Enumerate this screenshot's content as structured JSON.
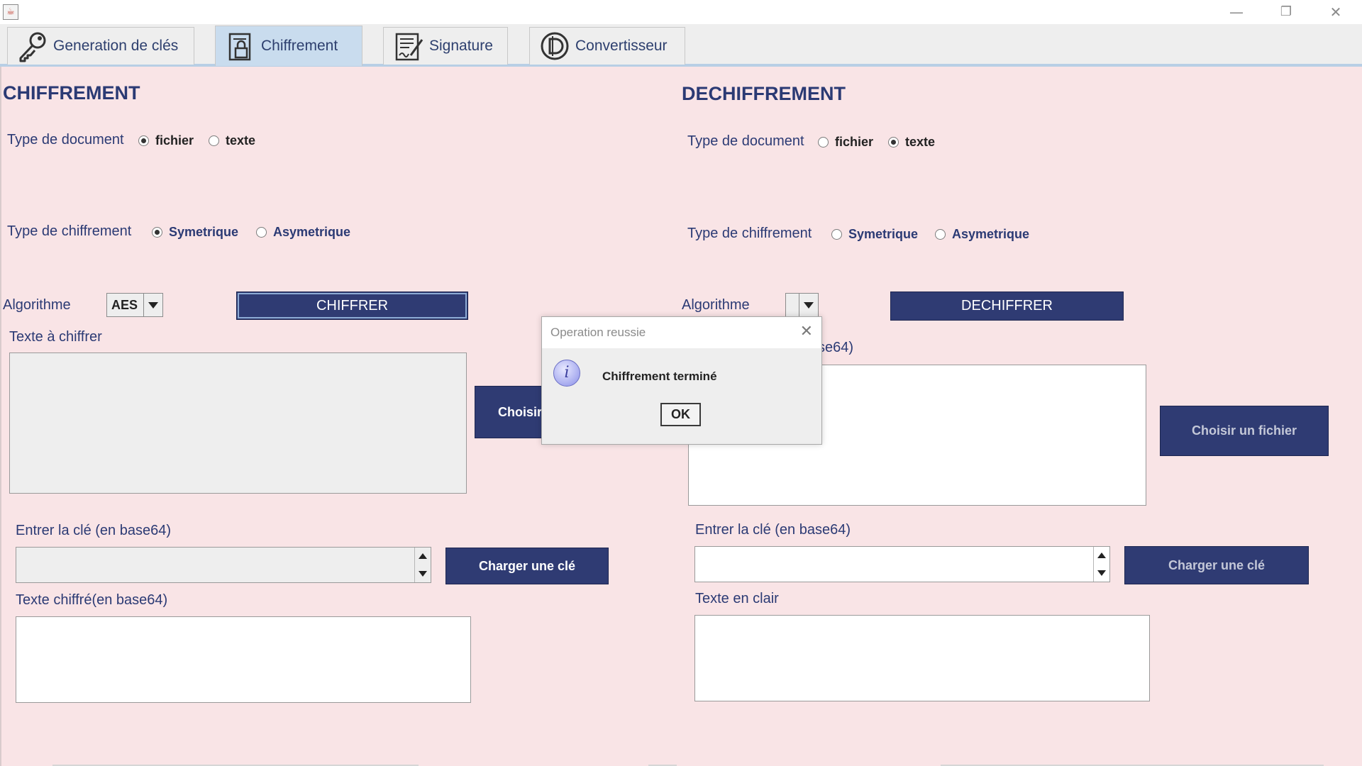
{
  "window": {
    "minimize_glyph": "—",
    "restore_glyph": "❐",
    "close_glyph": "✕"
  },
  "tabs": [
    {
      "label": "Generation de clés",
      "icon": "key-icon",
      "active": false
    },
    {
      "label": "Chiffrement",
      "icon": "lock-document-icon",
      "active": true
    },
    {
      "label": "Signature",
      "icon": "signature-document-icon",
      "active": false
    },
    {
      "label": "Convertisseur",
      "icon": "converter-icon",
      "active": false
    }
  ],
  "encrypt": {
    "title": "CHIFFREMENT",
    "doc_type_label": "Type de document",
    "doc_type_options": [
      "fichier",
      "texte"
    ],
    "doc_type_selected": "fichier",
    "cipher_type_label": "Type de chiffrement",
    "cipher_type_options": [
      "Symetrique",
      "Asymetrique"
    ],
    "cipher_type_selected": "Symetrique",
    "algorithm_label": "Algorithme",
    "algorithm_value": "AES",
    "action_button": "CHIFFRER",
    "text_label": "Texte à chiffrer",
    "choose_file_button": "Choisir",
    "key_label": "Entrer la clé (en base64)",
    "load_key_button": "Charger une clé",
    "output_label": "Texte chiffré(en base64)"
  },
  "decrypt": {
    "title": "DECHIFFREMENT",
    "doc_type_label": "Type de document",
    "doc_type_options": [
      "fichier",
      "texte"
    ],
    "doc_type_selected": "texte",
    "cipher_type_label": "Type de chiffrement",
    "cipher_type_options": [
      "Symetrique",
      "Asymetrique"
    ],
    "cipher_type_selected": "",
    "algorithm_label": "Algorithme",
    "algorithm_value": "",
    "action_button": "DECHIFFRER",
    "text_label_visible": "se64)",
    "choose_file_button": "Choisir un fichier",
    "key_label": "Entrer la clé (en base64)",
    "load_key_button": "Charger une clé",
    "output_label": "Texte en clair"
  },
  "dialog": {
    "title": "Operation reussie",
    "message": "Chiffrement terminé",
    "ok_button": "OK",
    "close_glyph": "✕",
    "info_glyph": "i"
  },
  "colors": {
    "panel_bg": "#f9e4e6",
    "accent": "#2f3b73",
    "text": "#2b3a74",
    "active_tab": "#c9dcee"
  }
}
